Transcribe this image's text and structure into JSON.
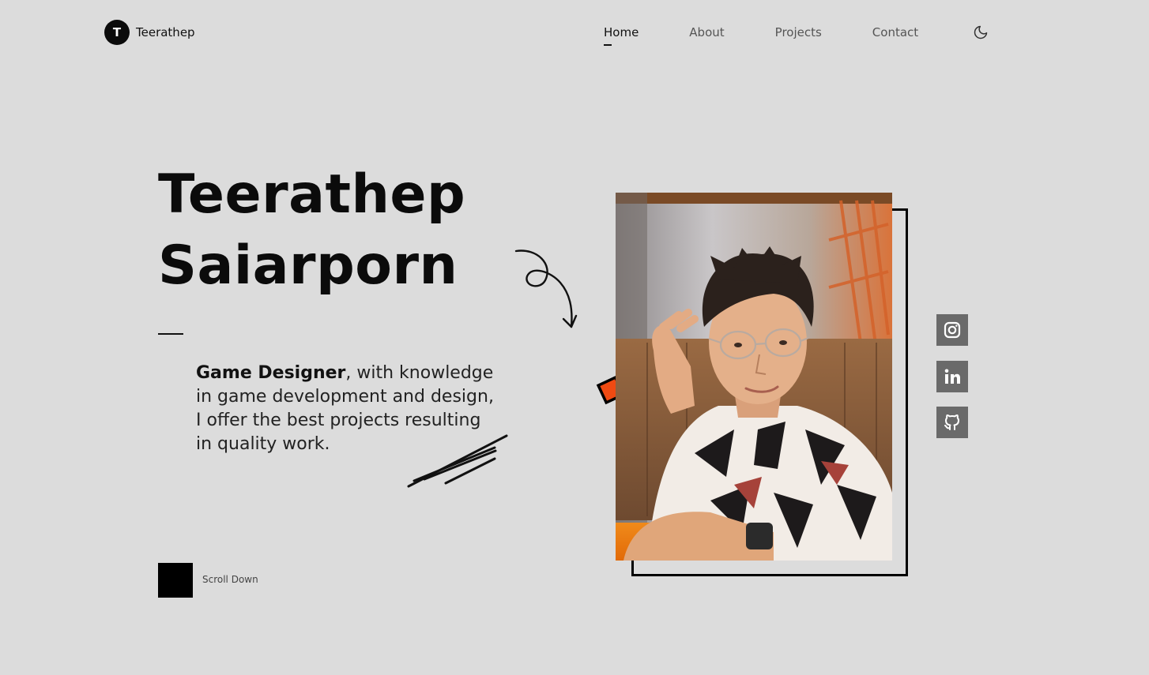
{
  "brand": {
    "initial": "T",
    "name": "Teerathep"
  },
  "nav": {
    "items": [
      {
        "label": "Home",
        "active": true
      },
      {
        "label": "About",
        "active": false
      },
      {
        "label": "Projects",
        "active": false
      },
      {
        "label": "Contact",
        "active": false
      }
    ],
    "theme_icon": "moon-icon"
  },
  "hero": {
    "name_line1": "Teerathep",
    "name_line2": "Saiarporn",
    "role": "Game Designer",
    "description": ", with knowledge in game development and design, I offer the best projects resulting in quality work."
  },
  "scroll": {
    "label": "Scroll Down"
  },
  "photo": {
    "alt": "Portrait of Teerathep Saiarporn"
  },
  "socials": [
    {
      "icon": "instagram-icon"
    },
    {
      "icon": "linkedin-icon"
    },
    {
      "icon": "github-icon"
    }
  ],
  "colors": {
    "background": "#dcdcdc",
    "text": "#111111",
    "accent": "#f04a12",
    "social_bg": "#6a6a6a"
  }
}
